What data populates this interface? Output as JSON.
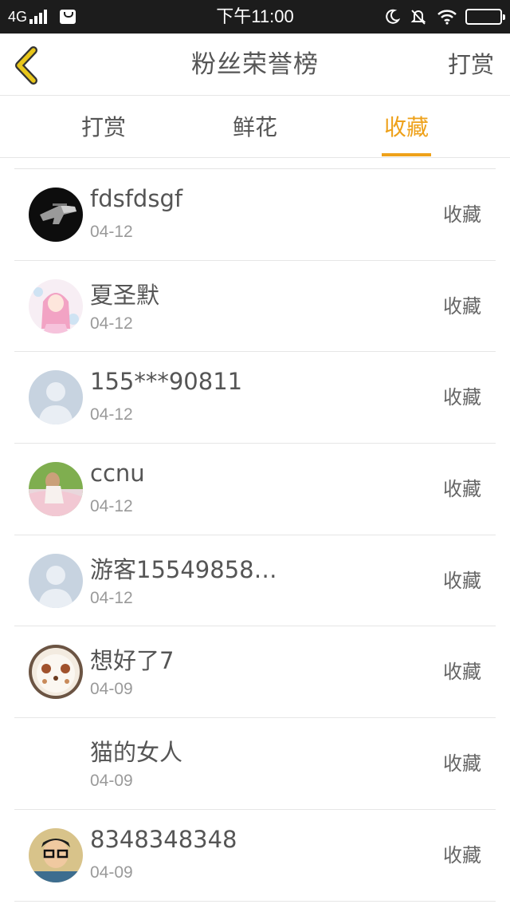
{
  "status_bar": {
    "network": "4G",
    "time": "下午11:00",
    "icons": [
      "signal-icon",
      "message-icon",
      "moon-icon",
      "mute-icon",
      "wifi-icon",
      "battery-icon"
    ]
  },
  "nav": {
    "back_icon": "chevron-left-icon",
    "title": "粉丝荣誉榜",
    "action": "打赏"
  },
  "tabs": [
    {
      "label": "打赏",
      "active": false
    },
    {
      "label": "鲜花",
      "active": false
    },
    {
      "label": "收藏",
      "active": true
    }
  ],
  "colors": {
    "accent": "#eea11a",
    "back_icon": "#e8c61a",
    "text": "#555555",
    "subtext": "#9a9a9a"
  },
  "list": [
    {
      "name": "fdsfdsgf",
      "date": "04-12",
      "type": "收藏",
      "avatar": "gun-photo-avatar"
    },
    {
      "name": "夏圣默",
      "date": "04-12",
      "type": "收藏",
      "avatar": "anime-girl-avatar"
    },
    {
      "name": "155***90811",
      "date": "04-12",
      "type": "收藏",
      "avatar": "default-user-avatar"
    },
    {
      "name": "ccnu",
      "date": "04-12",
      "type": "收藏",
      "avatar": "girl-photo-avatar"
    },
    {
      "name": "游客15549858…",
      "date": "04-12",
      "type": "收藏",
      "avatar": "default-user-avatar"
    },
    {
      "name": "想好了7",
      "date": "04-09",
      "type": "收藏",
      "avatar": "latte-art-avatar"
    },
    {
      "name": "猫的女人",
      "date": "04-09",
      "type": "收藏",
      "avatar": "blank-avatar"
    },
    {
      "name": "8348348348",
      "date": "04-09",
      "type": "收藏",
      "avatar": "boy-glasses-avatar"
    }
  ]
}
